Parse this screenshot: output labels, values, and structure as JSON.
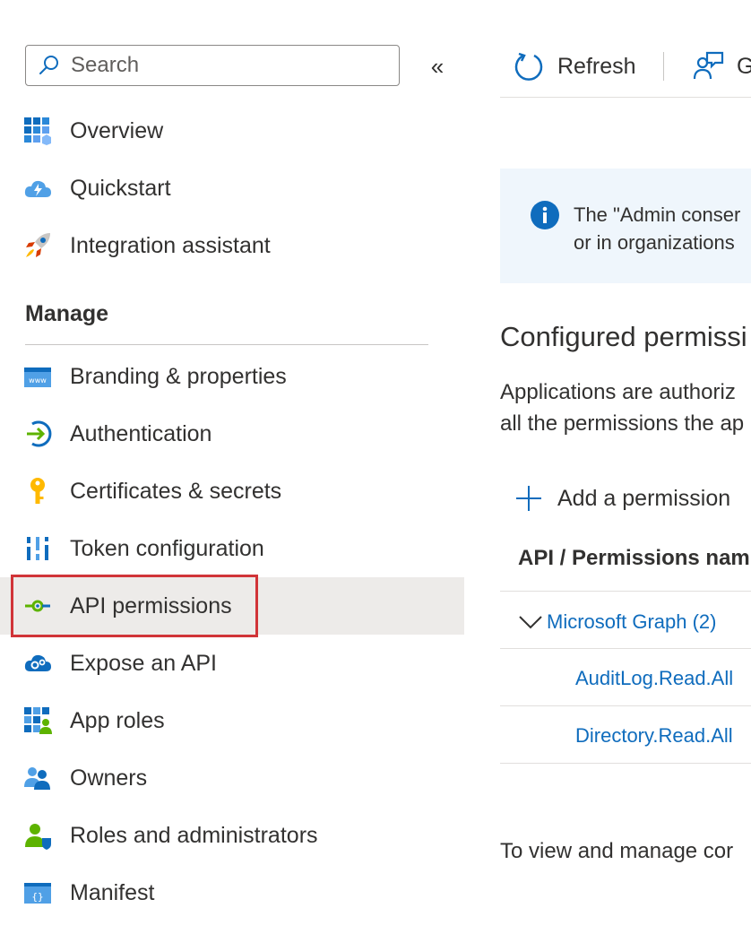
{
  "search": {
    "placeholder": "Search"
  },
  "collapse_glyph": "«",
  "nav": {
    "top_items": [
      {
        "label": "Overview",
        "icon": "overview-grid-icon"
      },
      {
        "label": "Quickstart",
        "icon": "quickstart-cloud-icon"
      },
      {
        "label": "Integration assistant",
        "icon": "rocket-icon"
      }
    ],
    "manage_heading": "Manage",
    "manage_items": [
      {
        "label": "Branding & properties",
        "icon": "www-window-icon"
      },
      {
        "label": "Authentication",
        "icon": "sign-in-arrow-icon"
      },
      {
        "label": "Certificates & secrets",
        "icon": "key-icon"
      },
      {
        "label": "Token configuration",
        "icon": "token-bars-icon"
      },
      {
        "label": "API permissions",
        "icon": "api-permissions-icon",
        "selected": true
      },
      {
        "label": "Expose an API",
        "icon": "cloud-gear-icon"
      },
      {
        "label": "App roles",
        "icon": "app-roles-icon"
      },
      {
        "label": "Owners",
        "icon": "owners-people-icon"
      },
      {
        "label": "Roles and administrators",
        "icon": "roles-admin-icon"
      },
      {
        "label": "Manifest",
        "icon": "manifest-braces-icon"
      }
    ]
  },
  "toolbar": {
    "refresh_label": "Refresh",
    "feedback_label": "G"
  },
  "info_banner": {
    "line1": "The \"Admin conser",
    "line2": "or in organizations"
  },
  "configured": {
    "title": "Configured permissi",
    "desc_line1": "Applications are authoriz",
    "desc_line2": "all the permissions the ap",
    "add_permission_label": "Add a permission",
    "column_header": "API / Permissions nam",
    "group_label": "Microsoft Graph (2)",
    "permissions": [
      "AuditLog.Read.All",
      "Directory.Read.All"
    ]
  },
  "footer": {
    "text": "To view and manage cor"
  },
  "colors": {
    "accent_blue": "#0f6cbd",
    "selected_bg": "#edebe9",
    "highlight_outline": "#d13438",
    "banner_bg": "#eff6fc"
  }
}
